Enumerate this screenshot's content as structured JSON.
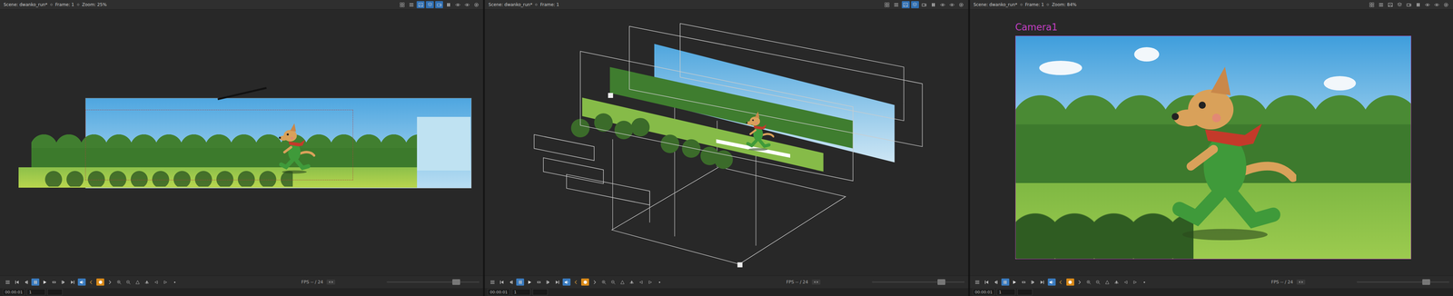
{
  "panels": [
    {
      "view": "top",
      "title_parts": [
        "Scene: dwanko_run*",
        "Frame: 1",
        "Zoom: 25%"
      ],
      "header_icons": [
        {
          "kind": "grid",
          "active": false
        },
        {
          "kind": "menu",
          "active": false
        },
        {
          "kind": "stage",
          "active": true
        },
        {
          "kind": "layers",
          "active": true
        },
        {
          "kind": "camera",
          "active": true
        },
        {
          "kind": "pause",
          "active": false
        },
        {
          "kind": "eye",
          "active": false
        },
        {
          "kind": "eye",
          "active": false
        },
        {
          "kind": "gear",
          "active": false
        }
      ]
    },
    {
      "view": "perspective",
      "title_parts": [
        "Scene: dwanko_run*",
        "Frame: 1"
      ],
      "header_icons": [
        {
          "kind": "grid",
          "active": false
        },
        {
          "kind": "menu",
          "active": false
        },
        {
          "kind": "stage",
          "active": true
        },
        {
          "kind": "layers",
          "active": true
        },
        {
          "kind": "camera",
          "active": false
        },
        {
          "kind": "pause",
          "active": false
        },
        {
          "kind": "eye",
          "active": false
        },
        {
          "kind": "eye",
          "active": false
        },
        {
          "kind": "gear",
          "active": false
        }
      ]
    },
    {
      "view": "camera",
      "title_parts": [
        "Scene: dwanko_run*",
        "Frame: 1",
        "Zoom: 84%"
      ],
      "camera_label": "Camera1",
      "header_icons": [
        {
          "kind": "grid",
          "active": false
        },
        {
          "kind": "menu",
          "active": false
        },
        {
          "kind": "stage",
          "active": false
        },
        {
          "kind": "layers",
          "active": false
        },
        {
          "kind": "camera",
          "active": false
        },
        {
          "kind": "pause",
          "active": false
        },
        {
          "kind": "eye",
          "active": false
        },
        {
          "kind": "eye",
          "active": false
        },
        {
          "kind": "gear",
          "active": false
        }
      ]
    }
  ],
  "playback": {
    "fps": "FPS -- / 24",
    "timecode": "00:00:01",
    "frame": "1",
    "zoom_level": 0.75,
    "toolbar": [
      {
        "kind": "menu",
        "active": false
      },
      {
        "kind": "first",
        "active": false
      },
      {
        "kind": "prev",
        "active": false
      },
      {
        "kind": "pause",
        "active": true
      },
      {
        "kind": "play",
        "active": false
      },
      {
        "kind": "loop",
        "active": false
      },
      {
        "kind": "next",
        "active": false
      },
      {
        "kind": "last",
        "active": false
      },
      {
        "kind": "sound",
        "active": true
      },
      {
        "kind": "onion-prev",
        "active": false
      },
      {
        "kind": "onion",
        "active": true
      },
      {
        "kind": "onion-next",
        "active": false
      },
      {
        "kind": "zoom-in",
        "active": false
      },
      {
        "kind": "zoom-out",
        "active": false
      },
      {
        "kind": "reset",
        "active": false
      },
      {
        "kind": "flip",
        "active": false
      },
      {
        "kind": "rotate-left",
        "active": false
      },
      {
        "kind": "rotate-right",
        "active": false
      },
      {
        "kind": "dot",
        "active": false
      }
    ]
  }
}
